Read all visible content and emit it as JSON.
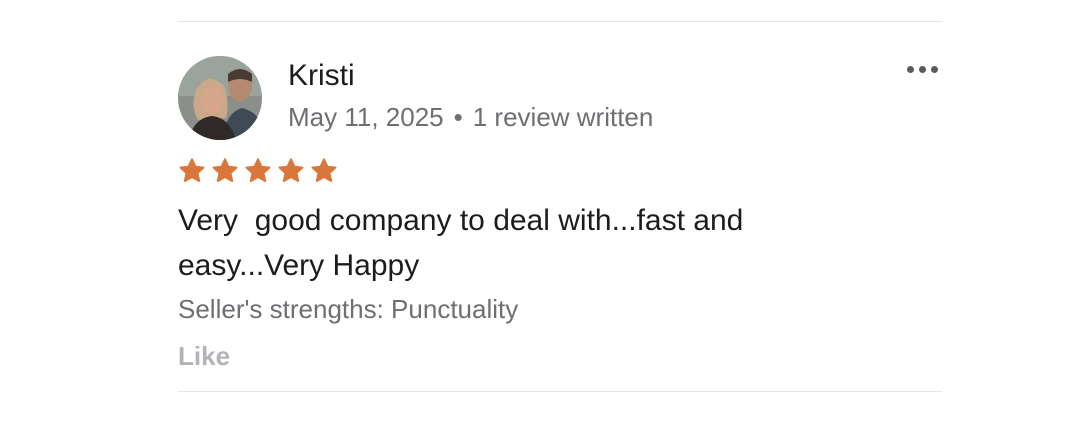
{
  "review": {
    "author_name": "Kristi",
    "date": "May 11, 2025",
    "separator": "•",
    "review_count": "1 review written",
    "rating": 5,
    "rating_max": 5,
    "star_color": "#d9773a",
    "text": "Very  good company to deal with...fast and\neasy...Very Happy",
    "strengths": "Seller's strengths: Punctuality",
    "like_label": "Like"
  },
  "icons": {
    "more": "more-horizontal-icon",
    "star": "star-icon"
  }
}
